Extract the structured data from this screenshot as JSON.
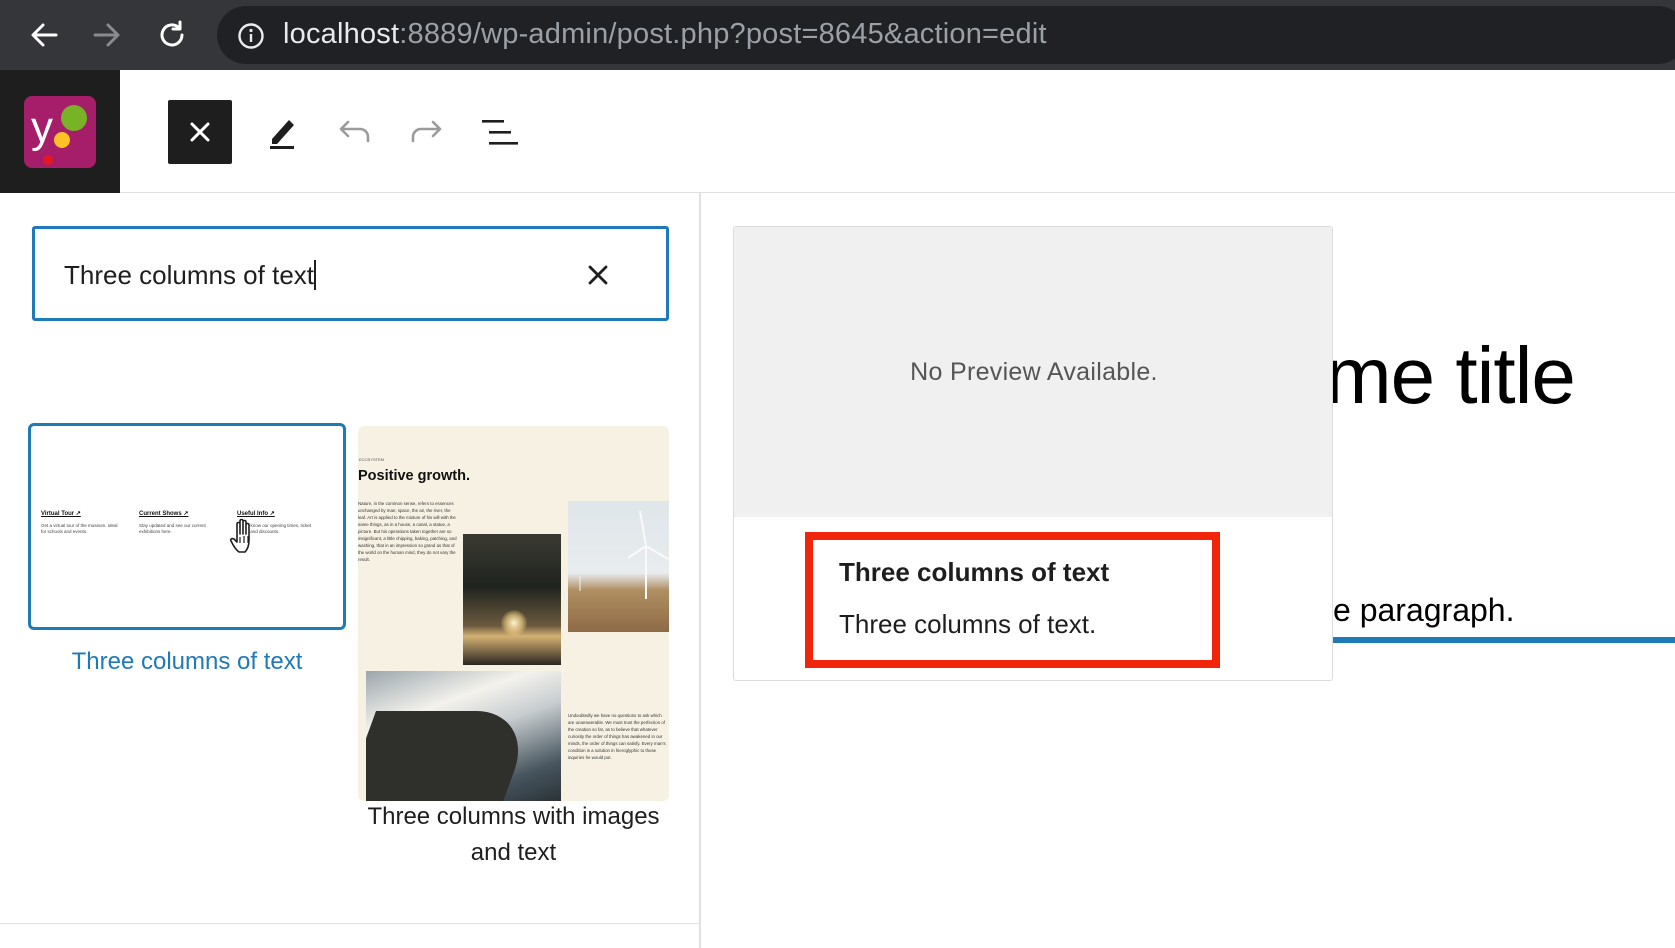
{
  "browser": {
    "url_host": "localhost",
    "url_rest": ":8889/wp-admin/post.php?post=8645&action=edit"
  },
  "inserter": {
    "search_value": "Three columns of text",
    "patterns": [
      {
        "label": "Three columns of text",
        "preview_columns": [
          {
            "heading": "Virtual Tour ↗",
            "text": "Get a virtual tour of the museum. Ideal for schools and events."
          },
          {
            "heading": "Current Shows ↗",
            "text": "Stay updated and see our current exhibitions here."
          },
          {
            "heading": "Useful Info ↗",
            "text": "Get to know our opening times, ticket prices and discounts."
          }
        ]
      },
      {
        "label": "Three columns with images and text",
        "eyebrow": "ECOSYSTEM",
        "title": "Positive growth.",
        "body1": "Nature, in the common sense, refers to essences unchanged by man; space, the air, the river, the leaf. Art is applied to the mixture of his will with the same things, as in a house, a canal, a statue, a picture. But his operations taken together are so insignificant, a little chipping, baking, patching, and washing, that in an impression so grand as that of the world on the human mind, they do not vary the result.",
        "body2": "Undoubtedly we have no questions to ask which are unanswerable. We must trust the perfection of the creation so far, as to believe that whatever curiosity the order of things has awakened in our minds, the order of things can satisfy. Every man's condition is a solution in hieroglyphic to those inquiries he would put."
      }
    ]
  },
  "preview": {
    "placeholder": "No Preview Available.",
    "title": "Three columns of text",
    "description": "Three columns of text."
  },
  "editor": {
    "title_fragment": "me title",
    "paragraph_fragment": "e paragraph."
  },
  "colors": {
    "accent": "#1f7ab8",
    "highlight": "#f0250c"
  }
}
